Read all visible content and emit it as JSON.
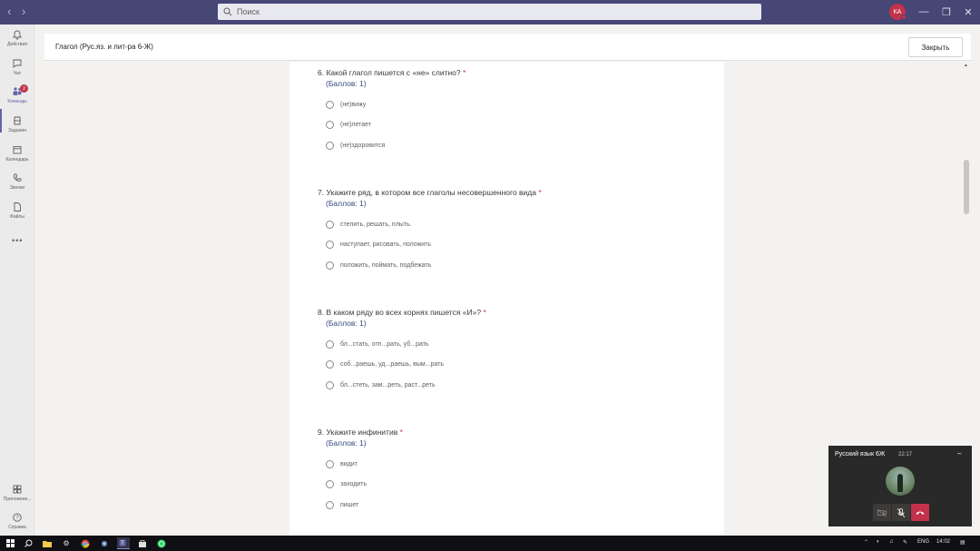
{
  "search": {
    "placeholder": "Поиск"
  },
  "user": {
    "initials": "КА"
  },
  "rail": [
    {
      "label": "Действия",
      "icon": "bell-icon",
      "name": "rail-item-activity"
    },
    {
      "label": "Чат",
      "icon": "chat-icon",
      "name": "rail-item-chat"
    },
    {
      "label": "Команды",
      "icon": "teams-icon",
      "name": "rail-item-teams",
      "badge": "2"
    },
    {
      "label": "Задания",
      "icon": "assignments-icon",
      "name": "rail-item-assignments"
    },
    {
      "label": "Календарь",
      "icon": "calendar-icon",
      "name": "rail-item-calendar"
    },
    {
      "label": "Звонки",
      "icon": "phone-icon",
      "name": "rail-item-calls"
    },
    {
      "label": "Файлы",
      "icon": "file-icon",
      "name": "rail-item-files"
    },
    {
      "label": "Приложени...",
      "icon": "apps-icon",
      "name": "rail-item-apps"
    },
    {
      "label": "Справка",
      "icon": "help-icon",
      "name": "rail-item-help"
    }
  ],
  "header": {
    "title": "Глагол (Рус.яз. и лит-ра 6-Ж)",
    "close_label": "Закрыть"
  },
  "questions": [
    {
      "title": "6. Какой  глагол пишется с «не» слитно?",
      "required": "*",
      "points": "(Баллов: 1)",
      "options": [
        "(не)вижу",
        "(не)летает",
        "(не)здоровится"
      ]
    },
    {
      "title": "7. Укажите ряд, в котором все глаголы несовершенного вида",
      "required": "*",
      "points": "(Баллов: 1)",
      "options": [
        "стелить, решать, плыть.",
        "наступает, рисовать, положить",
        "положить, поймать, подбежать"
      ]
    },
    {
      "title": "8. В каком ряду во всех корнях пишется «И»?",
      "required": "*",
      "points": "(Баллов: 1)",
      "options": [
        "бл...стать, отп...рать, уб...рать",
        "соб...раешь, уд...раешь, вым...рать",
        "бл...стеть, зам...реть, раст...реть"
      ]
    },
    {
      "title": "9. Укажите инфинитив",
      "required": "*",
      "points": "(Баллов: 1)",
      "options": [
        "видит",
        "заходить",
        "пишет"
      ]
    }
  ],
  "call": {
    "title": "Русский язык 6Ж",
    "time": "22:17"
  },
  "taskbar": {
    "lang": "ENG",
    "clock": "14:02"
  },
  "colors": {
    "accent": "#6264a7",
    "titlebar": "#464775",
    "required": "#c4314b",
    "points": "#35497d"
  }
}
